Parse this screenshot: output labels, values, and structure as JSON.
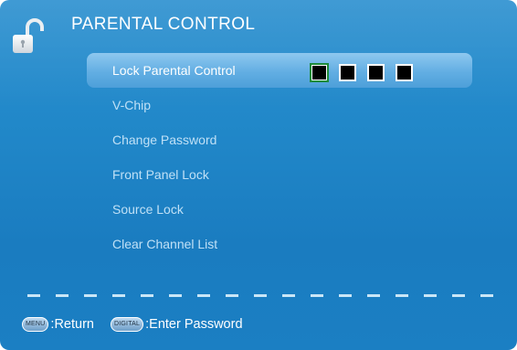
{
  "header": {
    "title": "PARENTAL CONTROL",
    "icon": "padlock-icon"
  },
  "menu": {
    "items": [
      {
        "label": "Lock Parental Control",
        "active": true
      },
      {
        "label": "V-Chip"
      },
      {
        "label": "Change Password"
      },
      {
        "label": "Front Panel Lock"
      },
      {
        "label": "Source Lock"
      },
      {
        "label": "Clear Channel List"
      }
    ],
    "pin": {
      "digits": 4,
      "focused_index": 0
    }
  },
  "footer": {
    "return": {
      "key": "MENU",
      "text": ":Return"
    },
    "password": {
      "key": "DIGITAL",
      "text": ":Enter Password"
    }
  },
  "colors": {
    "background": "#2188c9",
    "highlight": "#62aee3",
    "focus": "#1d8a3a",
    "inactive_text": "#bfe0f6"
  }
}
